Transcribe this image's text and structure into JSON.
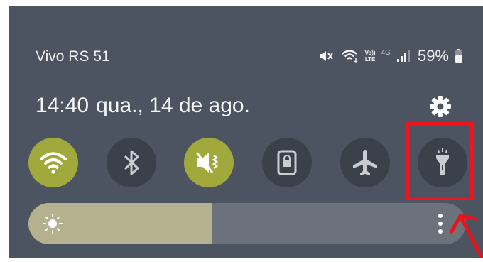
{
  "status_bar": {
    "carrier": "Vivo RS 51",
    "volte_top": "Vo))",
    "volte_bottom": "LTE",
    "network": "4G",
    "battery_percent": "59%",
    "icons": [
      "mute-vibrate-icon",
      "wifi-data-icon",
      "volte-icon",
      "signal-icon",
      "battery-icon"
    ]
  },
  "clock": {
    "time": "14:40",
    "date": "qua., 14 de ago."
  },
  "settings_icon": "gear-icon",
  "quick_tiles": [
    {
      "icon": "wifi-icon",
      "state": "on"
    },
    {
      "icon": "bluetooth-icon",
      "state": "off"
    },
    {
      "icon": "sound-mute-icon",
      "state": "on"
    },
    {
      "icon": "screen-lock-rotation-icon",
      "state": "off"
    },
    {
      "icon": "airplane-icon",
      "state": "off"
    },
    {
      "icon": "flashlight-icon",
      "state": "off"
    }
  ],
  "brightness": {
    "level": 0.42,
    "icon": "sun-icon",
    "more_icon": "more-vertical-icon"
  },
  "colors": {
    "panel_bg": "#4b5460",
    "tile_on": "#a2a93c",
    "tile_off": "#3a414b",
    "highlight": "#f0141e"
  }
}
